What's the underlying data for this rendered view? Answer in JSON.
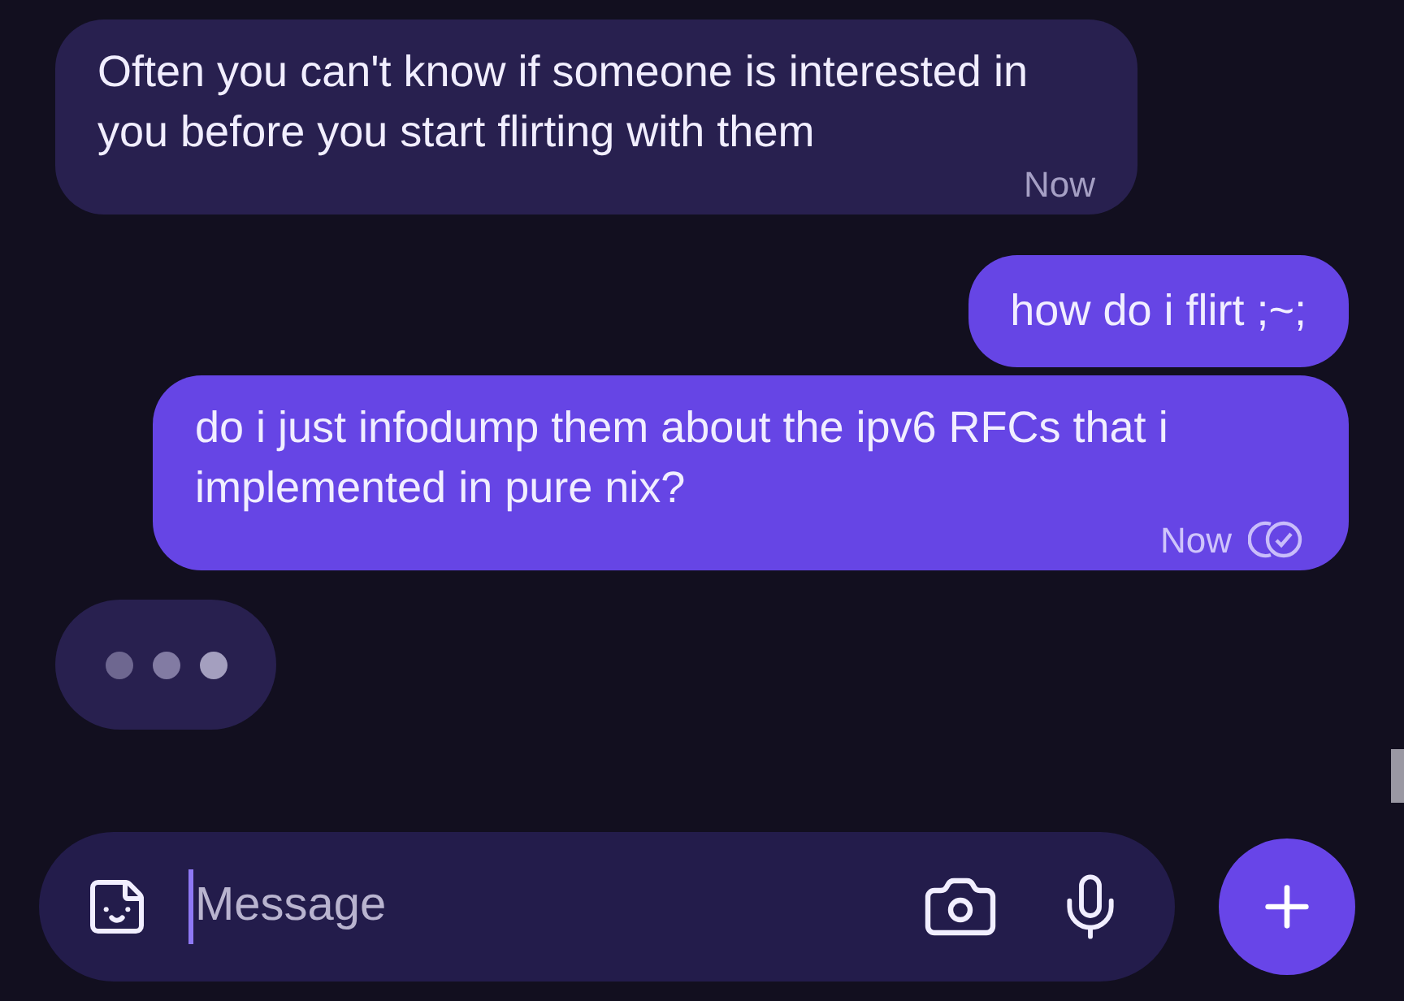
{
  "messages": [
    {
      "kind": "incoming",
      "text": "Often you can't know if someone is interested in you before you start flirting with them",
      "time": "Now"
    },
    {
      "kind": "outgoing",
      "text": "how do i flirt ;~;"
    },
    {
      "kind": "outgoing",
      "text": "do i just infodump them about the ipv6 RFCs that i implemented in pure nix?",
      "time": "Now",
      "delivered": true
    }
  ],
  "typing": true,
  "composer": {
    "placeholder": "Message"
  }
}
